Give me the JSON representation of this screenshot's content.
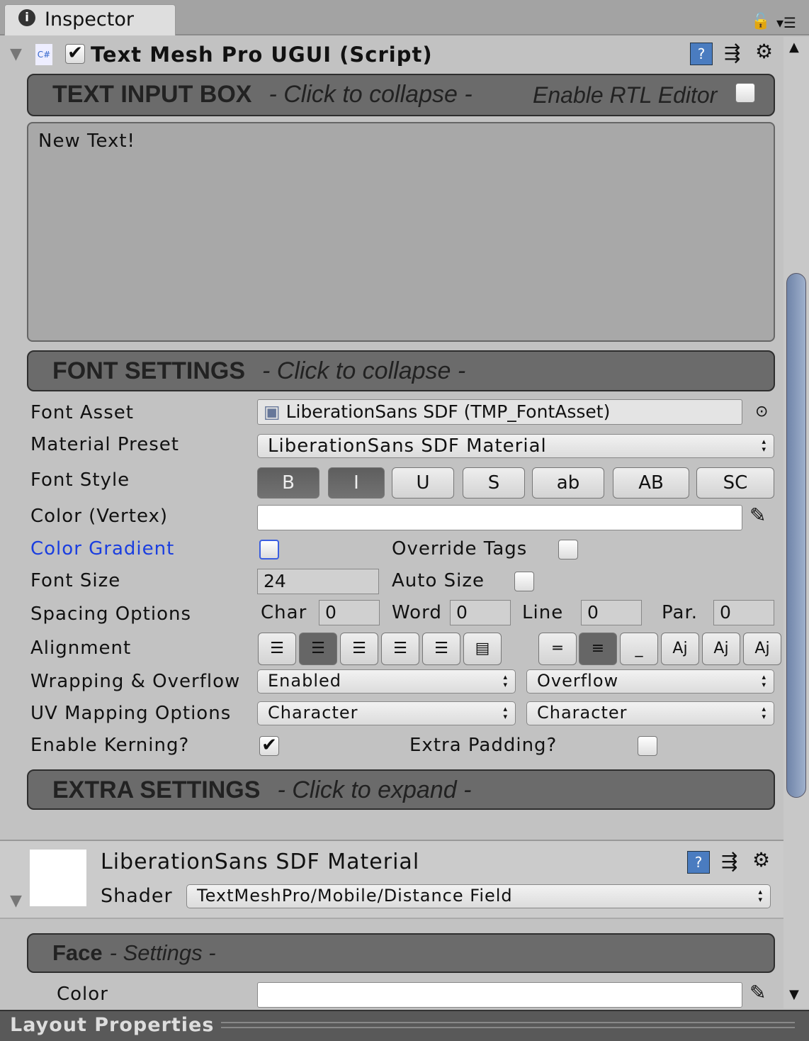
{
  "tab": {
    "title": "Inspector"
  },
  "component": {
    "title": "Text Mesh Pro UGUI (Script)",
    "enabled": true
  },
  "text_input": {
    "header": "TEXT INPUT BOX",
    "hint": "- Click to collapse -",
    "rtl_label": "Enable RTL Editor",
    "rtl": false,
    "text": "New Text!"
  },
  "font_settings": {
    "header": "FONT SETTINGS",
    "hint": "- Click to collapse -",
    "font_asset_label": "Font Asset",
    "font_asset": "LiberationSans SDF (TMP_FontAsset)",
    "material_preset_label": "Material Preset",
    "material_preset": "LiberationSans SDF Material",
    "font_style_label": "Font Style",
    "styles": [
      "B",
      "I",
      "U",
      "S",
      "ab",
      "AB",
      "SC"
    ],
    "color_label": "Color (Vertex)",
    "color": "#ffffff",
    "gradient_label": "Color Gradient",
    "override_tags_label": "Override Tags",
    "font_size_label": "Font Size",
    "font_size": "24",
    "auto_size_label": "Auto Size",
    "spacing_label": "Spacing Options",
    "char_label": "Char",
    "char": "0",
    "word_label": "Word",
    "word": "0",
    "line_label": "Line",
    "line": "0",
    "par_label": "Par.",
    "par": "0",
    "alignment_label": "Alignment",
    "wrapping_label": "Wrapping & Overflow",
    "wrapping": "Enabled",
    "overflow": "Overflow",
    "uv_label": "UV Mapping Options",
    "uv_h": "Character",
    "uv_v": "Character",
    "kerning_label": "Enable Kerning?",
    "kerning": true,
    "padding_label": "Extra Padding?",
    "padding": false
  },
  "extra": {
    "header": "EXTRA SETTINGS",
    "hint": "- Click to expand -"
  },
  "material": {
    "name": "LiberationSans SDF Material",
    "shader_label": "Shader",
    "shader": "TextMeshPro/Mobile/Distance Field"
  },
  "face": {
    "header": "Face",
    "hint": "- Settings -",
    "color_label": "Color"
  },
  "layout": {
    "title": "Layout Properties"
  },
  "colors": {
    "link": "#1a3ee0",
    "header": "#6b6b6b"
  }
}
